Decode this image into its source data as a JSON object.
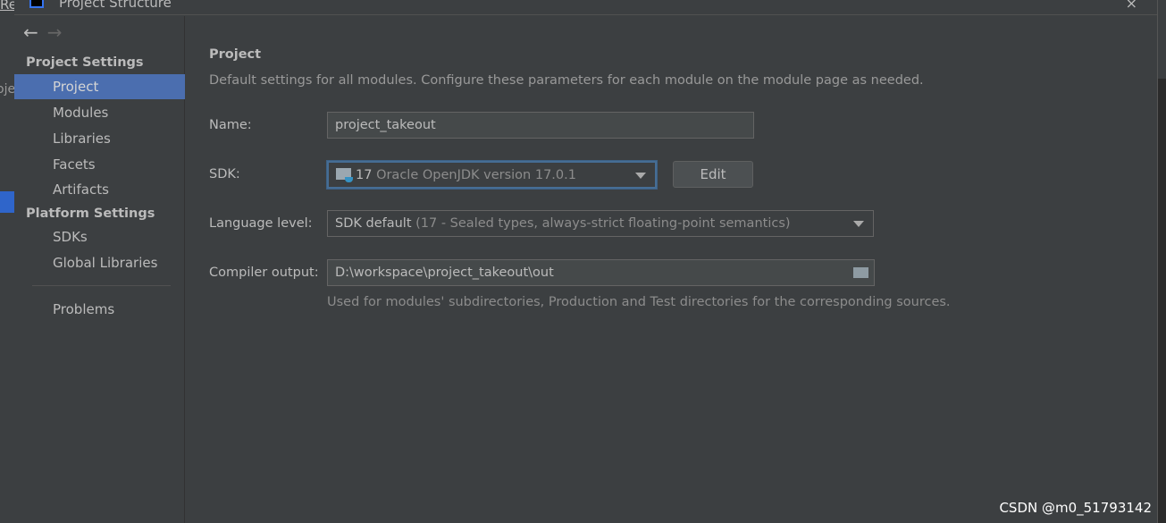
{
  "background": {
    "left_title": "Re",
    "left_text": "oje"
  },
  "window": {
    "title": "Project Structure",
    "close": "×"
  },
  "nav": {
    "back": "←",
    "forward": "→"
  },
  "sidebar": {
    "project_settings": "Project Settings",
    "platform_settings": "Platform Settings",
    "items": [
      {
        "label": "Project"
      },
      {
        "label": "Modules"
      },
      {
        "label": "Libraries"
      },
      {
        "label": "Facets"
      },
      {
        "label": "Artifacts"
      }
    ],
    "platform_items": [
      {
        "label": "SDKs"
      },
      {
        "label": "Global Libraries"
      }
    ],
    "problems": "Problems"
  },
  "main": {
    "heading": "Project",
    "description": "Default settings for all modules. Configure these parameters for each module on the module page as needed.",
    "name_label": "Name:",
    "name_value": "project_takeout",
    "sdk_label": "SDK:",
    "sdk_version": "17",
    "sdk_name": "Oracle OpenJDK version 17.0.1",
    "edit_label": "Edit",
    "language_label": "Language level:",
    "language_value": "SDK default",
    "language_detail": "(17 - Sealed types, always-strict floating-point semantics)",
    "compiler_label": "Compiler output:",
    "compiler_value": "D:\\workspace\\project_takeout\\out",
    "compiler_help": "Used for modules' subdirectories, Production and Test directories for the corresponding sources."
  },
  "watermark": "CSDN @m0_51793142"
}
